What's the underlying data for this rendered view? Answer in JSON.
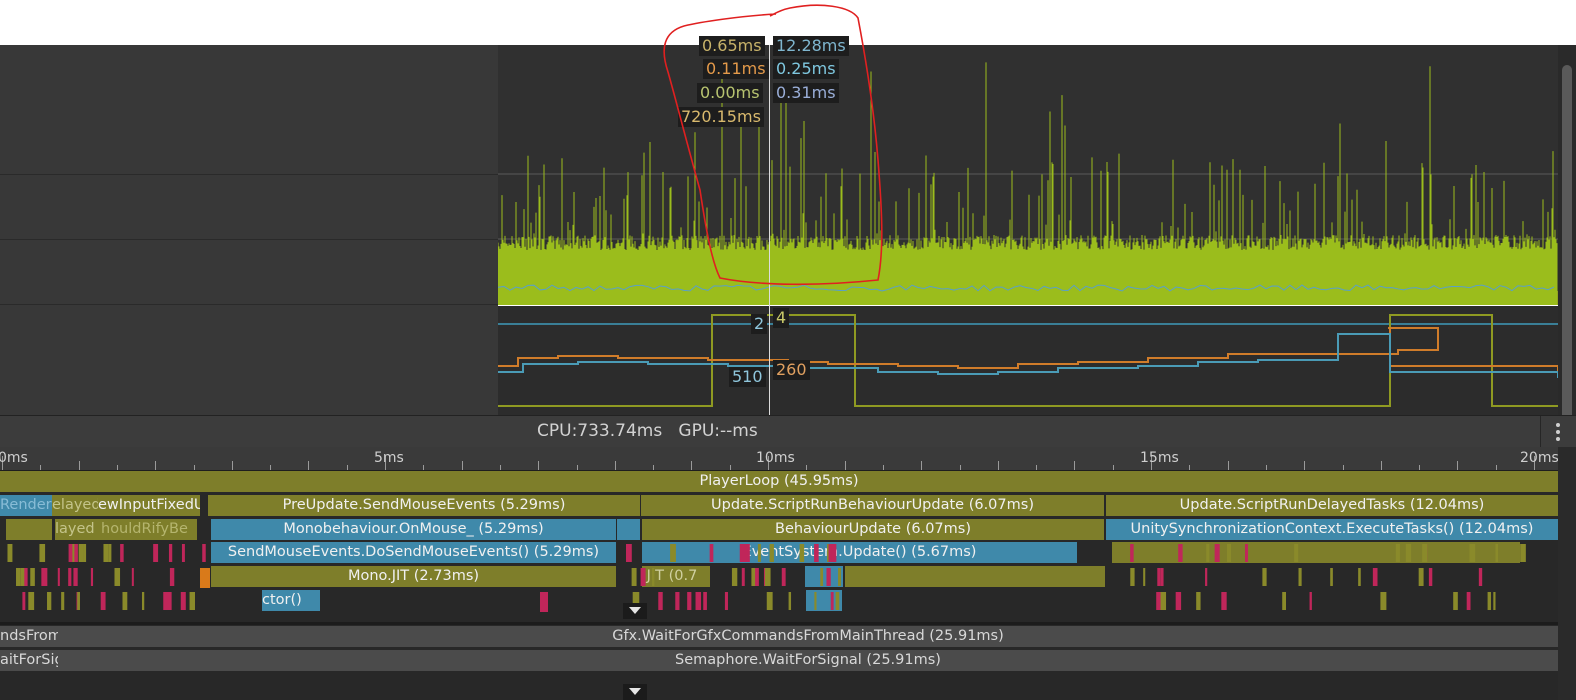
{
  "tooltips_left": [
    "0.65ms",
    "0.11ms",
    "0.00ms",
    "720.15ms"
  ],
  "tooltips_right": [
    "12.28ms",
    "0.25ms",
    "0.31ms"
  ],
  "lower_tooltips": {
    "a": "2",
    "b": "4",
    "c": "510",
    "d": "260"
  },
  "status": {
    "text": "CPU:733.74ms   GPU:--ms"
  },
  "ruler": {
    "labels": [
      "0ms",
      "5ms",
      "10ms",
      "15ms",
      "20ms"
    ]
  },
  "bars": {
    "player_loop": "PlayerLoop (45.95ms)",
    "pre_update": "PreUpdate.SendMouseEvents (5.29ms)",
    "update_script": "Update.ScriptRunBehaviourUpdate (6.07ms)",
    "update_delayed": "Update.ScriptRunDelayedTasks (12.04ms)",
    "mono_onmouse": "Monobehaviour.OnMouse_ (5.29ms)",
    "behaviour_update": "BehaviourUpdate (6.07ms)",
    "unity_sync": "UnitySynchronizationContext.ExecuteTasks() (12.04ms)",
    "send_mouse": "SendMouseEvents.DoSendMouseEvents() (5.29ms)",
    "event_system": "EventSystem.Update() (5.67ms)",
    "mono_jit": "Mono.JIT (2.73ms)",
    "jit_small": ".JIT (0.7",
    "ctor": "ctor()",
    "render_frag": "Render",
    "delayed_frag": "elayed",
    "newinput_frag": "ewInputFixedU",
    "layed_frag": "layed",
    "should_frag": "houldRifyBe",
    "gfx_wait": "Gfx.WaitForGfxCommandsFromMainThread (25.91ms)",
    "semaphore": "Semaphore.WaitForSignal (25.91ms)",
    "gfx_frag": "ndsFrom",
    "sem_frag": "aitForSig"
  },
  "colors": {
    "olive": "#7e7e2a",
    "blue": "#3f89aa",
    "green_series": "#9bbd1c",
    "annotation": "#e02020"
  },
  "icons": [
    "collapse-triangle-icon",
    "kebab-menu-icon"
  ]
}
